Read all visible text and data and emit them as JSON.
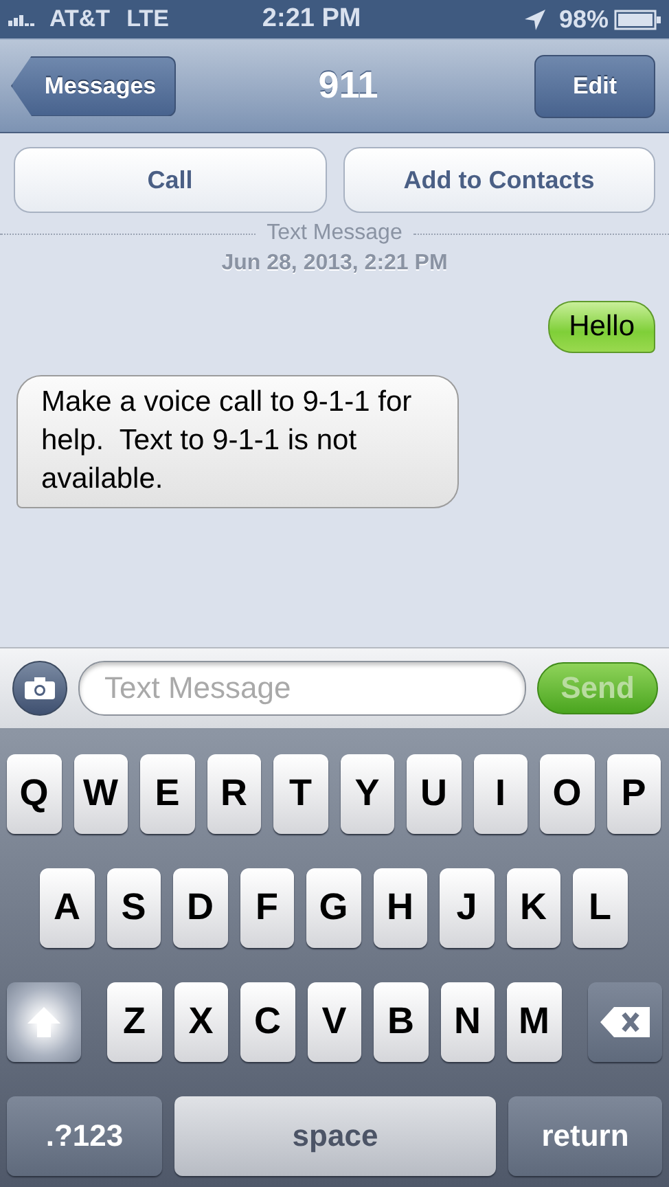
{
  "status_bar": {
    "carrier": "AT&T",
    "network": "LTE",
    "time": "2:21 PM",
    "battery": "98%"
  },
  "nav": {
    "back": "Messages",
    "title": "911",
    "edit": "Edit"
  },
  "actions": [
    "Call",
    "Add to Contacts"
  ],
  "divider_label": "Text Message",
  "timestamp": "Jun 28, 2013, 2:21 PM",
  "messages": [
    {
      "kind": "outgoing",
      "text": "Hello"
    },
    {
      "kind": "incoming",
      "text": "Make a voice call to 9-1-1 for help.  Text to 9-1-1 is not available."
    }
  ],
  "composer": {
    "placeholder": "Text Message",
    "send": "Send",
    "send_disabled": true
  },
  "keyboard": {
    "rows": [
      [
        "Q",
        "W",
        "E",
        "R",
        "T",
        "Y",
        "U",
        "I",
        "O",
        "P"
      ],
      [
        "A",
        "S",
        "D",
        "F",
        "G",
        "H",
        "J",
        "K",
        "L"
      ],
      [
        "Z",
        "X",
        "C",
        "V",
        "B",
        "N",
        "M"
      ]
    ],
    "shift_on": true,
    "bottom": [
      ".?123",
      "space",
      "return"
    ]
  }
}
